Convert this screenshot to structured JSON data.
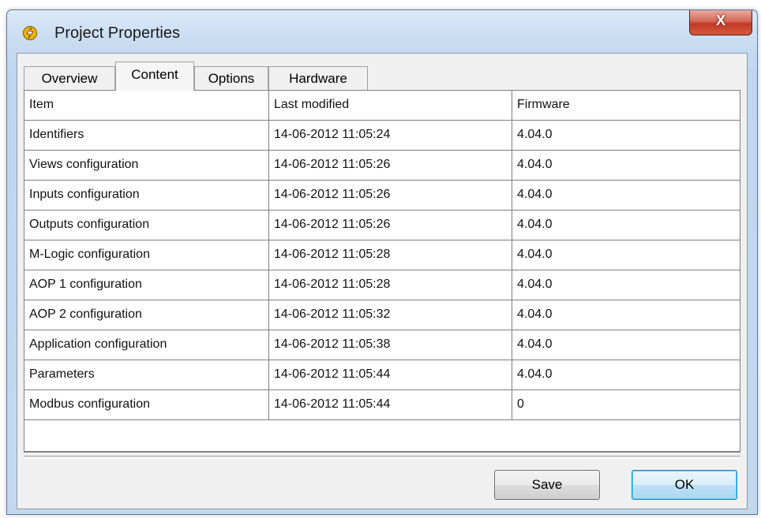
{
  "window": {
    "title": "Project Properties",
    "close_glyph": "X"
  },
  "tabs": [
    {
      "label": "Overview",
      "active": false
    },
    {
      "label": "Content",
      "active": true
    },
    {
      "label": "Options",
      "active": false
    },
    {
      "label": "Hardware",
      "active": false
    }
  ],
  "table": {
    "columns": [
      "Item",
      "Last modified",
      "Firmware"
    ],
    "rows": [
      [
        "Identifiers",
        "14-06-2012 11:05:24",
        "4.04.0"
      ],
      [
        "Views configuration",
        "14-06-2012 11:05:26",
        "4.04.0"
      ],
      [
        "Inputs configuration",
        "14-06-2012 11:05:26",
        "4.04.0"
      ],
      [
        "Outputs configuration",
        "14-06-2012 11:05:26",
        "4.04.0"
      ],
      [
        "M-Logic configuration",
        "14-06-2012 11:05:28",
        "4.04.0"
      ],
      [
        "AOP 1 configuration",
        "14-06-2012 11:05:28",
        "4.04.0"
      ],
      [
        "AOP 2 configuration",
        "14-06-2012 11:05:32",
        "4.04.0"
      ],
      [
        "Application configuration",
        "14-06-2012 11:05:38",
        "4.04.0"
      ],
      [
        "Parameters",
        "14-06-2012 11:05:44",
        "4.04.0"
      ],
      [
        "Modbus configuration",
        "14-06-2012 11:05:44",
        "0"
      ]
    ]
  },
  "buttons": {
    "save": "Save",
    "ok": "OK"
  },
  "icons": {
    "app": "lightning-bolt-icon",
    "close": "close-icon"
  },
  "colors": {
    "title_bar": "#c8dcf2",
    "close_button": "#c23a28",
    "app_icon": "#f3b200",
    "default_button_border": "#3c7fb1"
  }
}
